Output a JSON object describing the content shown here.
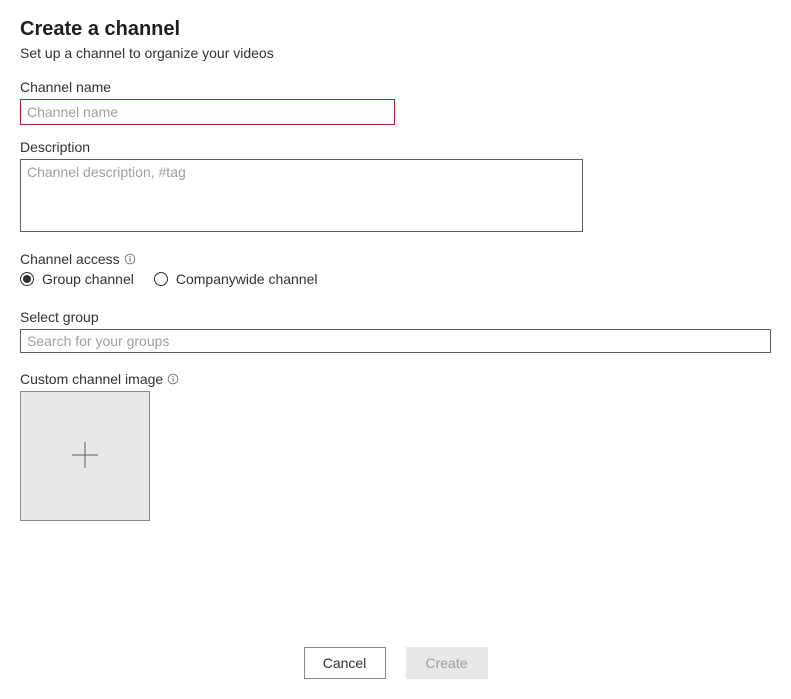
{
  "header": {
    "title": "Create a channel",
    "subtitle": "Set up a channel to organize your videos"
  },
  "channelName": {
    "label": "Channel name",
    "placeholder": "Channel name",
    "value": ""
  },
  "description": {
    "label": "Description",
    "placeholder": "Channel description, #tag",
    "value": ""
  },
  "channelAccess": {
    "label": "Channel access",
    "options": {
      "group": "Group channel",
      "companywide": "Companywide channel"
    },
    "selected": "group"
  },
  "selectGroup": {
    "label": "Select group",
    "placeholder": "Search for your groups",
    "value": ""
  },
  "customImage": {
    "label": "Custom channel image"
  },
  "buttons": {
    "cancel": "Cancel",
    "create": "Create"
  }
}
